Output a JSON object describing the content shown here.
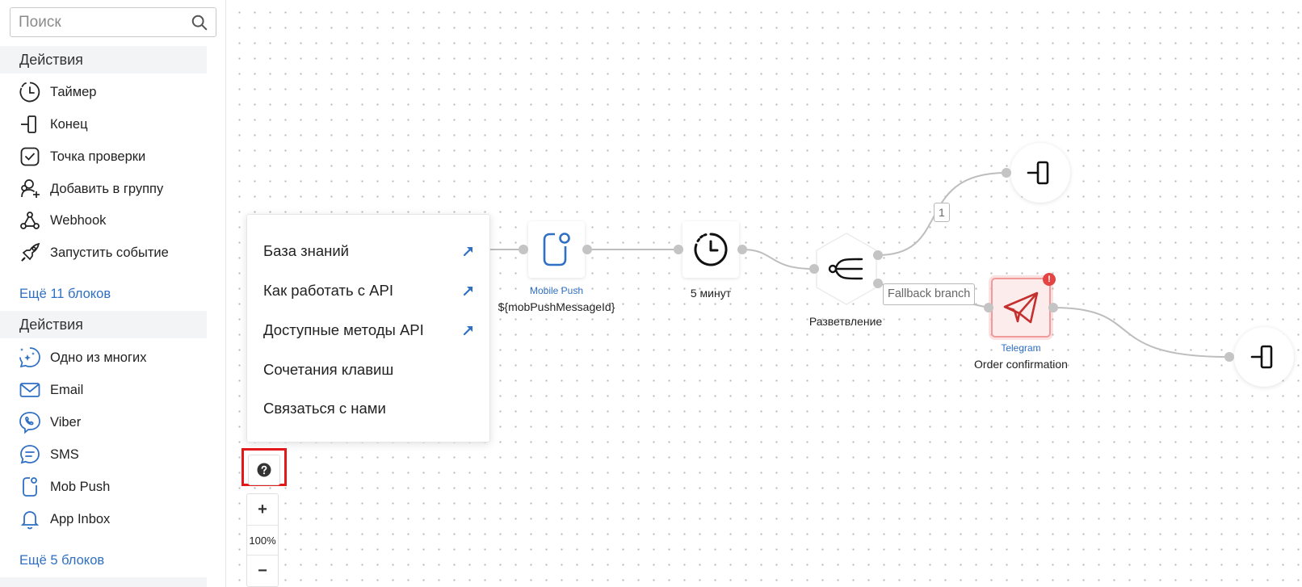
{
  "search": {
    "placeholder": "Поиск"
  },
  "sidebar": {
    "section1": {
      "title": "Действия",
      "items": [
        {
          "label": "Таймер",
          "icon": "timer-icon"
        },
        {
          "label": "Конец",
          "icon": "end-icon"
        },
        {
          "label": "Точка проверки",
          "icon": "checkpoint-icon"
        },
        {
          "label": "Добавить в группу",
          "icon": "add-to-group-icon"
        },
        {
          "label": "Webhook",
          "icon": "webhook-icon"
        },
        {
          "label": "Запустить событие",
          "icon": "rocket-icon"
        }
      ],
      "more": "Ещё 11 блоков"
    },
    "section2": {
      "title": "Действия",
      "items": [
        {
          "label": "Одно из многих",
          "icon": "sparkle-chat-icon"
        },
        {
          "label": "Email",
          "icon": "email-icon"
        },
        {
          "label": "Viber",
          "icon": "viber-icon"
        },
        {
          "label": "SMS",
          "icon": "sms-icon"
        },
        {
          "label": "Mob Push",
          "icon": "mobile-push-icon"
        },
        {
          "label": "App Inbox",
          "icon": "bell-icon"
        }
      ],
      "more": "Ещё 5 блоков"
    }
  },
  "help_menu": {
    "items": [
      {
        "label": "База знаний",
        "external": true
      },
      {
        "label": "Как работать с API",
        "external": true
      },
      {
        "label": "Доступные методы API",
        "external": true
      },
      {
        "label": "Сочетания клавиш",
        "external": false
      },
      {
        "label": "Связаться с нами",
        "external": false
      }
    ]
  },
  "canvas": {
    "nodes": {
      "mobile_push": {
        "type": "Mobile Push",
        "title": "${mobPushMessageId}"
      },
      "timer": {
        "title": "5 минут"
      },
      "branch": {
        "title": "Разветвление"
      },
      "telegram": {
        "type": "Telegram",
        "title": "Order confirmation",
        "error_badge": "!"
      }
    },
    "edge_labels": {
      "branch_1": "1",
      "fallback": "Fallback branch"
    }
  },
  "zoom": {
    "level": "100%",
    "plus": "+",
    "minus": "−"
  },
  "colors": {
    "accent": "#2f6fc4",
    "error": "#e34545",
    "highlight": "#e31919"
  }
}
